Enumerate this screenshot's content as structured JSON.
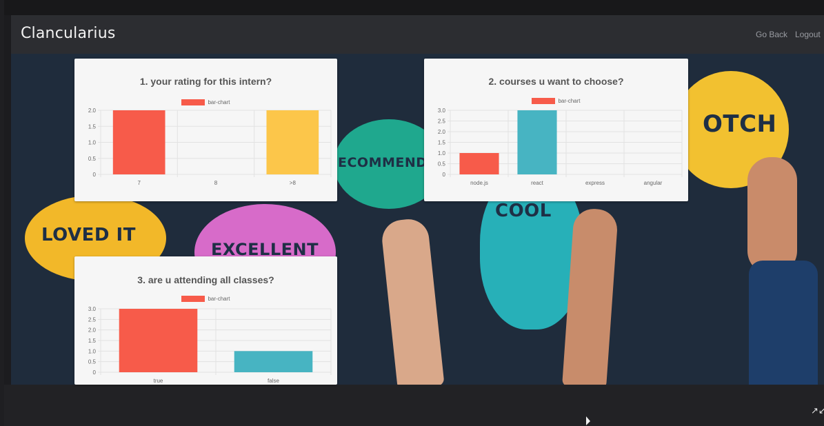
{
  "navbar": {
    "brand": "Clancularius",
    "links": [
      "Go Back",
      "Logout"
    ]
  },
  "background": {
    "bubbles": [
      "LOVED IT",
      "EXCELLENT",
      "ECOMMEND",
      "COOL",
      "OTCH"
    ]
  },
  "colors": {
    "red": "#f75b4a",
    "yellow": "#fcc64a",
    "teal": "#47b4c2",
    "navbar": "#2c2d31",
    "card": "#f6f6f6"
  },
  "icons": {
    "minimize": "minimize-icon",
    "cursor": "cursor-icon"
  },
  "chart_data": [
    {
      "type": "bar",
      "title": "1. your rating for this intern?",
      "legend": "bar-chart",
      "categories": [
        "7",
        "8",
        ">8"
      ],
      "values": [
        2,
        0,
        2
      ],
      "colors": [
        "#f75b4a",
        "#47b4c2",
        "#fcc64a"
      ],
      "yticks": [
        "0",
        "0.5",
        "1.0",
        "1.5",
        "2.0"
      ],
      "ylim": [
        0,
        2
      ]
    },
    {
      "type": "bar",
      "title": "2. courses u want to choose?",
      "legend": "bar-chart",
      "categories": [
        "node.js",
        "react",
        "express",
        "angular"
      ],
      "values": [
        1,
        3,
        0,
        0
      ],
      "colors": [
        "#f75b4a",
        "#47b4c2",
        "#fcc64a",
        "#9b9b9b"
      ],
      "yticks": [
        "0",
        "0.5",
        "1.0",
        "1.5",
        "2.0",
        "2.5",
        "3.0"
      ],
      "ylim": [
        0,
        3
      ]
    },
    {
      "type": "bar",
      "title": "3. are u attending all classes?",
      "legend": "bar-chart",
      "categories": [
        "true",
        "false"
      ],
      "values": [
        3,
        1
      ],
      "colors": [
        "#f75b4a",
        "#47b4c2"
      ],
      "yticks": [
        "0",
        "0.5",
        "1.0",
        "1.5",
        "2.0",
        "2.5",
        "3.0"
      ],
      "ylim": [
        0,
        3
      ]
    }
  ]
}
